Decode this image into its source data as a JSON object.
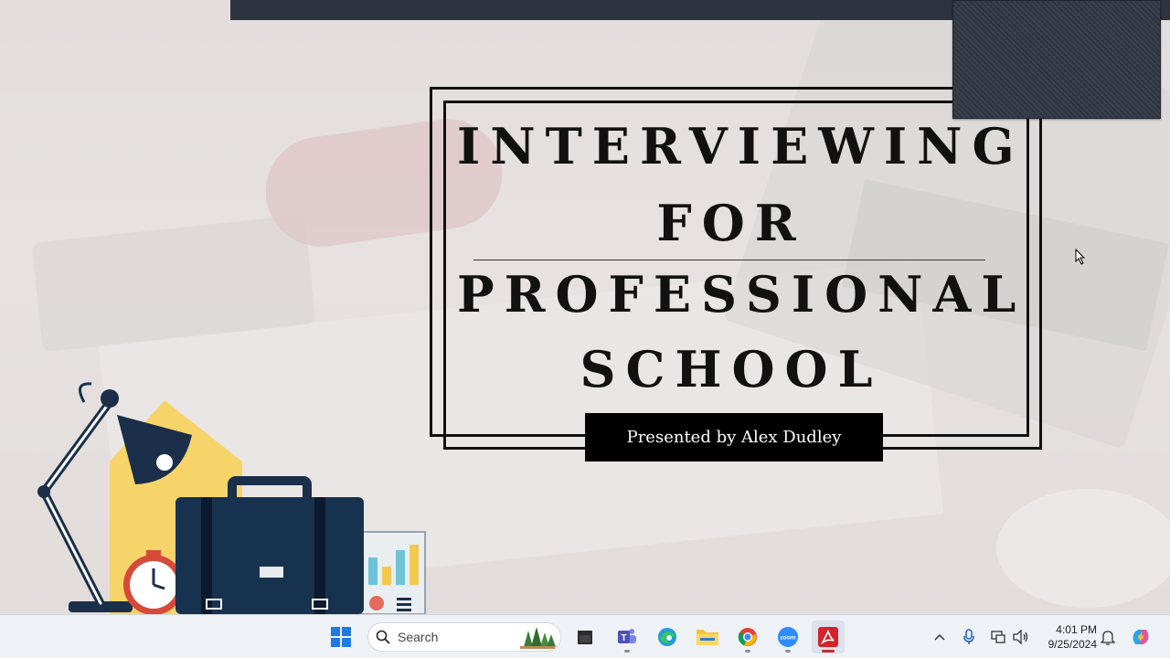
{
  "slide": {
    "title_lines": [
      "INTERVIEWING",
      "FOR",
      "PROFESSIONAL",
      "SCHOOL"
    ],
    "presenter": "Presented by Alex Dudley"
  },
  "taskbar": {
    "search_placeholder": "Search",
    "apps": [
      "start-icon",
      "search-icon",
      "file-manager-icon",
      "teams-icon",
      "edge-icon",
      "file-explorer-icon",
      "chrome-icon",
      "zoom-icon",
      "acrobat-icon"
    ],
    "active_app": "acrobat-icon",
    "tray_icons": [
      "chevron-up-icon",
      "microphone-icon",
      "network-icon",
      "volume-icon",
      "notification-icon",
      "copilot-icon"
    ]
  },
  "clock": {
    "time": "4:01 PM",
    "date": "9/25/2024"
  },
  "colors": {
    "frame": "#111111",
    "accent_dark": "#2c3440",
    "presenter_bg": "#000000"
  }
}
